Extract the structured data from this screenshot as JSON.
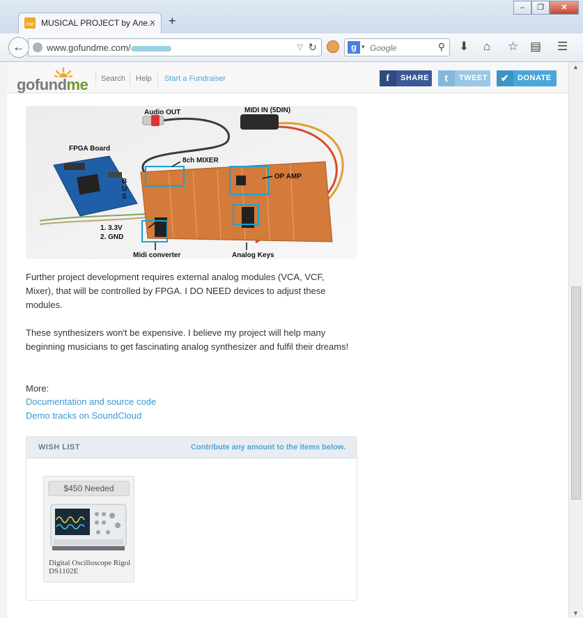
{
  "browser": {
    "tab_title": "MUSICAL PROJECT by Але...",
    "tab_close": "×",
    "new_tab": "+",
    "url": "www.gofundme.com/",
    "search_placeholder": "Google",
    "window_buttons": [
      "–",
      "❐",
      "✕"
    ]
  },
  "header": {
    "logo_go": "gofund",
    "logo_me": "me",
    "nav": {
      "search": "Search",
      "help": "Help",
      "start": "Start a Fundraiser"
    },
    "buttons": {
      "share": "SHARE",
      "tweet": "TWEET",
      "donate": "DONATE"
    },
    "colors": {
      "share": "#3b5998",
      "tweet": "#9ac7e6",
      "donate": "#49a6d9"
    }
  },
  "photo": {
    "labels": {
      "audio_out": "Audio OUT",
      "midi_in": "MIDI IN (5DIN)",
      "fpga": "FPGA Board",
      "mixer": "8ch MIXER",
      "opamp": "OP AMP",
      "bus": [
        "B",
        "U",
        "S"
      ],
      "power1": "1. 3.3V",
      "power2": "2. GND",
      "midi_conv": "Midi converter",
      "analog_keys": "Analog Keys"
    }
  },
  "content": {
    "para1": "Further project development requires external analog modules (VCA, VCF, Mixer), that will be controlled by FPGA. I DO NEED devices to adjust these modules.",
    "para2": "These synthesizers won't be expensive. I believe my project will help many beginning musicians to get fascinating analog synthesizer and fulfil their dreams!",
    "more": "More:",
    "link1": "Documentation and source code",
    "link2": "Demo tracks on SoundCloud"
  },
  "wishlist": {
    "title": "WISH LIST",
    "contribute": "Contribute any amount to the items below.",
    "items": [
      {
        "needed": "$450 Needed",
        "name": "Digital Oscilloscope Rigol DS1102E"
      }
    ]
  }
}
